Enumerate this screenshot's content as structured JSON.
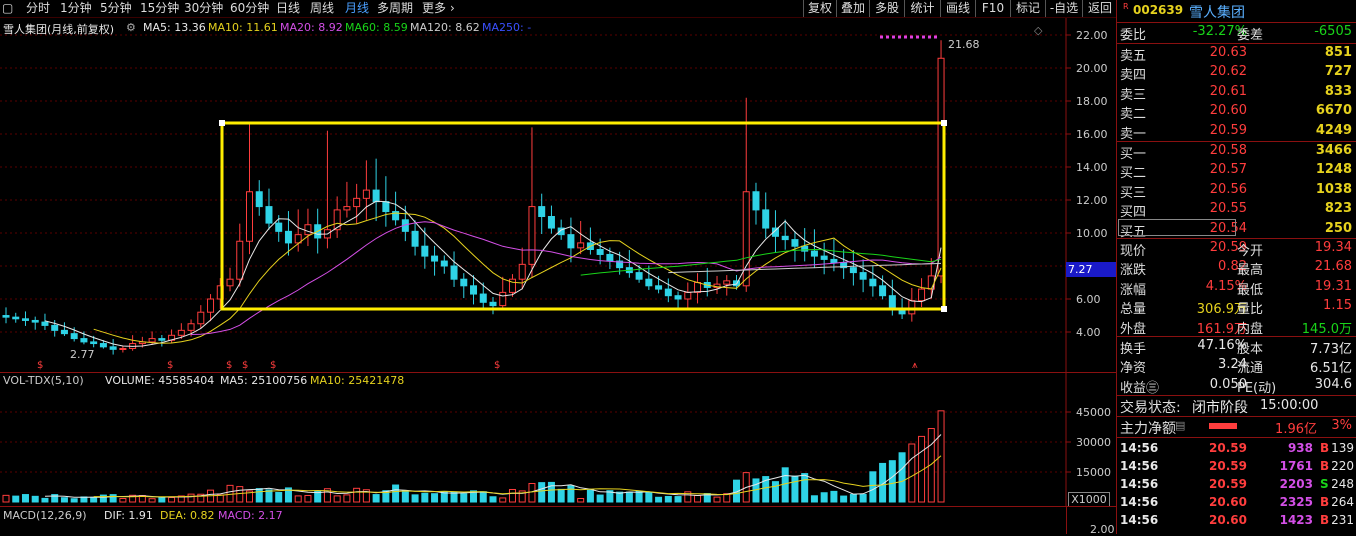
{
  "toolbar": {
    "periods": [
      "分时",
      "1分钟",
      "5分钟",
      "15分钟",
      "30分钟",
      "60分钟",
      "日线",
      "周线",
      "月线",
      "多周期",
      "更多"
    ],
    "active": "月线",
    "right_buttons": [
      "复权",
      "叠加",
      "多股",
      "统计",
      "画线",
      "F10",
      "标记",
      "-自选",
      "返回"
    ]
  },
  "main_chart": {
    "title": "雪人集团(月线,前复权)",
    "ma": [
      {
        "label": "MA5: 13.36",
        "color": "#e8e8e8"
      },
      {
        "label": "MA10: 11.61",
        "color": "#e6d21e"
      },
      {
        "label": "MA20: 8.92",
        "color": "#d34fe6"
      },
      {
        "label": "MA60: 8.59",
        "color": "#19d419"
      },
      {
        "label": "MA120: 8.62",
        "color": "#cccccc"
      },
      {
        "label": "MA250: -",
        "color": "#3a50ff"
      }
    ],
    "y_ticks": [
      "22.00",
      "20.00",
      "18.00",
      "16.00",
      "14.00",
      "12.00",
      "10.00",
      "8.00",
      "6.00",
      "4.00"
    ],
    "high_label": "21.68",
    "low_label": "2.77",
    "cursor_price": "7.27",
    "bottom_markers": [
      "$",
      "$",
      "$",
      "$",
      "$",
      "$",
      "$"
    ],
    "colors": {
      "up": "#ff3d3d",
      "down": "#2fd3e6",
      "box": "#ffee00"
    }
  },
  "volume_chart": {
    "label": "VOL-TDX(5,10)",
    "volume_text": "VOLUME: 45585404",
    "ma5_text": "MA5: 25100756",
    "ma10_text": "MA10: 25421478",
    "y_ticks": [
      "45000",
      "30000",
      "15000"
    ],
    "unit": "X1000"
  },
  "macd_chart": {
    "label": "MACD(12,26,9)",
    "dif": "DIF: 1.91",
    "dea": "DEA: 0.82",
    "macd": "MACD: 2.17",
    "y_tick": "2.00"
  },
  "panel": {
    "badge": "R",
    "code": "002639",
    "name": "雪人集团",
    "weibi_label": "委比",
    "weibi_value": "-32.27%",
    "weicha_label": "委差",
    "weicha_value": "-6505",
    "asks": [
      {
        "label": "卖五",
        "price": "20.63",
        "vol": "851"
      },
      {
        "label": "卖四",
        "price": "20.62",
        "vol": "727"
      },
      {
        "label": "卖三",
        "price": "20.61",
        "vol": "833"
      },
      {
        "label": "卖二",
        "price": "20.60",
        "vol": "6670"
      },
      {
        "label": "卖一",
        "price": "20.59",
        "vol": "4249"
      }
    ],
    "bids": [
      {
        "label": "买一",
        "price": "20.58",
        "vol": "3466"
      },
      {
        "label": "买二",
        "price": "20.57",
        "vol": "1248"
      },
      {
        "label": "买三",
        "price": "20.56",
        "vol": "1038"
      },
      {
        "label": "买四",
        "price": "20.55",
        "vol": "823"
      },
      {
        "label": "买五",
        "price": "20.54",
        "vol": "250"
      }
    ],
    "stats": [
      {
        "l1": "现价",
        "v1": "20.59",
        "c1": "red",
        "l2": "今开",
        "v2": "19.34",
        "c2": "red"
      },
      {
        "l1": "涨跌",
        "v1": "0.82",
        "c1": "red",
        "l2": "最高",
        "v2": "21.68",
        "c2": "red"
      },
      {
        "l1": "涨幅",
        "v1": "4.15%",
        "c1": "red",
        "l2": "最低",
        "v2": "19.31",
        "c2": "red"
      },
      {
        "l1": "总量",
        "v1": "306.9万",
        "c1": "yel",
        "l2": "量比",
        "v2": "1.15",
        "c2": "red"
      },
      {
        "l1": "外盘",
        "v1": "161.9万",
        "c1": "red",
        "l2": "内盘",
        "v2": "145.0万",
        "c2": "grn"
      }
    ],
    "stats2": [
      {
        "l1": "换手",
        "v1": "47.16%",
        "l2": "股本",
        "v2": "7.73亿"
      },
      {
        "l1": "净资",
        "v1": "3.24",
        "l2": "流通",
        "v2": "6.51亿"
      },
      {
        "l1": "收益㊂",
        "v1": "0.050",
        "l2": "PE(动)",
        "v2": "304.6"
      }
    ],
    "trade_status_label": "交易状态:",
    "trade_status_value": "闭市阶段",
    "trade_time": "15:00:00",
    "main_flow_label": "主力净额",
    "main_flow_value": "1.96亿",
    "main_flow_pct": "3%",
    "ticks": [
      {
        "time": "14:56",
        "price": "20.59",
        "vol": "938",
        "side": "B",
        "n": "139"
      },
      {
        "time": "14:56",
        "price": "20.59",
        "vol": "1761",
        "side": "B",
        "n": "220"
      },
      {
        "time": "14:56",
        "price": "20.59",
        "vol": "2203",
        "side": "S",
        "n": "248"
      },
      {
        "time": "14:56",
        "price": "20.60",
        "vol": "2325",
        "side": "B",
        "n": "264"
      },
      {
        "time": "14:56",
        "price": "20.60",
        "vol": "1423",
        "side": "B",
        "n": "231"
      }
    ]
  }
}
